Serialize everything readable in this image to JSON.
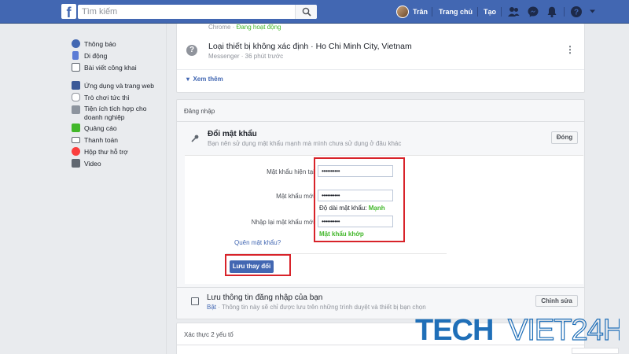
{
  "topbar": {
    "logo": "f",
    "search_placeholder": "Tìm kiếm",
    "user_name": "Trân",
    "home": "Trang chủ",
    "create": "Tạo"
  },
  "leftnav": {
    "group1": [
      {
        "label": "Thông báo",
        "icon": "globe-icon"
      },
      {
        "label": "Di động",
        "icon": "mobile-icon"
      },
      {
        "label": "Bài viết công khai",
        "icon": "rss-icon"
      }
    ],
    "group2": [
      {
        "label": "Ứng dụng và trang web",
        "icon": "apps-icon"
      },
      {
        "label": "Trò chơi tức thì",
        "icon": "game-icon"
      },
      {
        "label": "Tiện ích tích hợp cho doanh nghiệp",
        "icon": "business-icon"
      },
      {
        "label": "Quảng cáo",
        "icon": "ads-icon"
      },
      {
        "label": "Thanh toán",
        "icon": "card-icon"
      },
      {
        "label": "Hộp thư hỗ trợ",
        "icon": "support-icon"
      },
      {
        "label": "Video",
        "icon": "video-icon"
      }
    ]
  },
  "device": {
    "top_partial": "Chrome · ",
    "top_status": "Đang hoạt động",
    "title": "Loại thiết bị không xác định · Ho Chi Minh City, Vietnam",
    "subtitle": "Messenger · 36 phút trước",
    "see_more": "Xem thêm"
  },
  "login": {
    "section_title": "Đăng nhập",
    "change_password": {
      "title": "Đổi mật khẩu",
      "subtitle": "Bạn nên sử dụng mật khẩu mạnh mà mình chưa sử dụng ở đâu khác",
      "close_label": "Đóng",
      "current_label": "Mật khẩu hiện tại",
      "current_value": "••••••••••",
      "new_label": "Mật khẩu mới",
      "new_value": "••••••••••",
      "strength_label": "Độ dài mật khẩu: ",
      "strength_value": "Mạnh",
      "confirm_label": "Nhập lại mật khẩu mới",
      "confirm_value": "••••••••••",
      "match_label": "Mật khẩu khớp",
      "forgot_label": "Quên mật khẩu?",
      "save_label": "Lưu thay đổi"
    },
    "save_login": {
      "title": "Lưu thông tin đăng nhập của bạn",
      "subtitle_link": "Bật",
      "subtitle_text": " · Thông tin này sẽ chỉ được lưu trên những trình duyệt và thiết bị bạn chọn",
      "edit_label": "Chỉnh sửa"
    }
  },
  "two_factor": {
    "title": "Xác thực 2 yếu tố"
  },
  "watermark": {
    "text1": "TECH",
    "text2": "VIET24H"
  },
  "colors": {
    "brand": "#4267b2",
    "highlight": "#d8232a",
    "success": "#42b72a"
  }
}
